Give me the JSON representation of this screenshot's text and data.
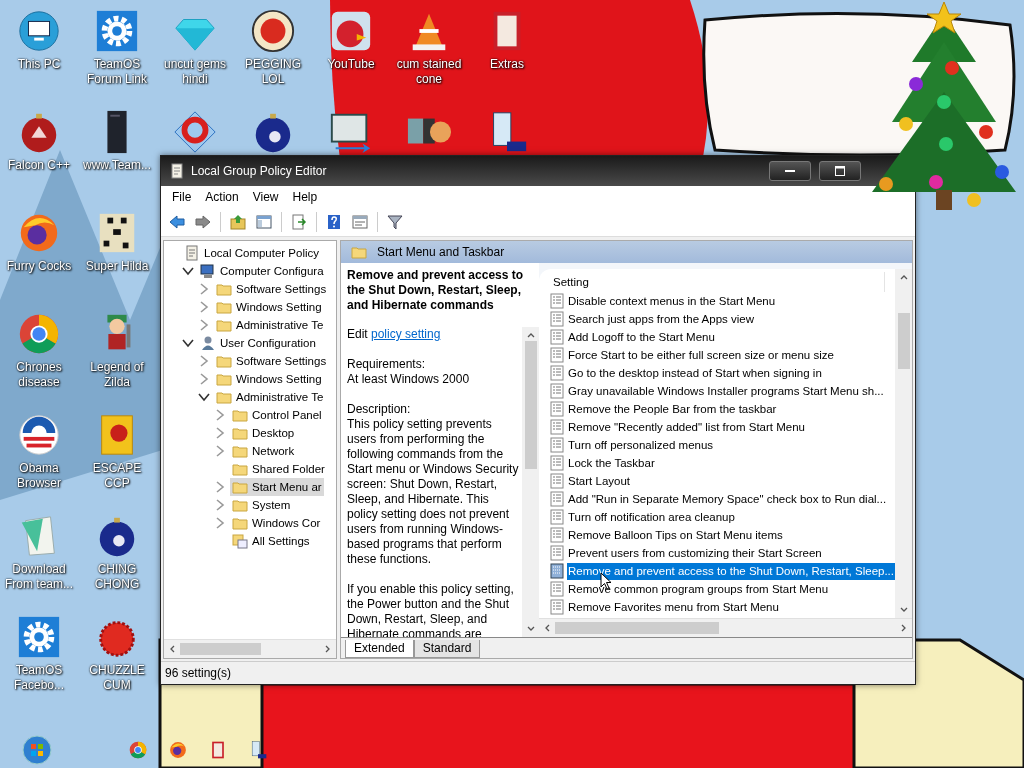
{
  "desktop": {
    "icon_columns": [
      [
        {
          "label": "This PC",
          "kind": "monitor"
        },
        {
          "label": "Falcon C++",
          "kind": "ornament"
        },
        {
          "label": "Furry Cocks",
          "kind": "flame"
        },
        {
          "label": "Chrones disease",
          "kind": "wheel"
        },
        {
          "label": "Obama Browser",
          "kind": "emblem"
        },
        {
          "label": "Download From team...",
          "kind": "notepad"
        },
        {
          "label": "TeamOS Facebo...",
          "kind": "gear"
        }
      ],
      [
        {
          "label": "TeamOS Forum Link",
          "kind": "gear"
        },
        {
          "label": "www.Team...",
          "kind": "book"
        },
        {
          "label": "Super Hilda",
          "kind": "pixel"
        },
        {
          "label": "Legend of Zilda",
          "kind": "character"
        },
        {
          "label": "ESCAPE CCP",
          "kind": "box"
        },
        {
          "label": "CHING CHONG",
          "kind": "ball"
        },
        {
          "label": "CHUZZLE CUM",
          "kind": "blob"
        }
      ],
      [
        {
          "label": "uncut gems hindi",
          "kind": "gem"
        },
        {
          "kind": "swirl"
        }
      ],
      [
        {
          "label": "PEGGING LOL",
          "kind": "disc"
        },
        {
          "kind": "ball"
        }
      ],
      [
        {
          "label": "YouTube",
          "kind": "bird"
        },
        {
          "kind": "code"
        }
      ],
      [
        {
          "label": "cum stained cone",
          "kind": "cone"
        },
        {
          "kind": "tiles"
        }
      ],
      [
        {
          "label": "Extras",
          "kind": "folder"
        },
        {
          "kind": "scroll"
        }
      ]
    ]
  },
  "window": {
    "title": "Local Group Policy Editor",
    "menu": [
      "File",
      "Action",
      "View",
      "Help"
    ]
  },
  "tree": [
    {
      "label": "Local Computer Policy",
      "kind": "policy",
      "selected": false,
      "children": [
        {
          "label": "Computer Configura",
          "kind": "computer",
          "expanded": true,
          "selected": false,
          "children": [
            {
              "label": "Software Settings",
              "kind": "folder",
              "expanded": false,
              "selected": false
            },
            {
              "label": "Windows Setting",
              "kind": "folder",
              "expanded": false,
              "selected": false
            },
            {
              "label": "Administrative Te",
              "kind": "folder",
              "expanded": false,
              "selected": false
            }
          ]
        },
        {
          "label": "User Configuration",
          "kind": "user",
          "expanded": true,
          "selected": false,
          "children": [
            {
              "label": "Software Settings",
              "kind": "folder",
              "expanded": false,
              "selected": false
            },
            {
              "label": "Windows Setting",
              "kind": "folder",
              "expanded": false,
              "selected": false
            },
            {
              "label": "Administrative Te",
              "kind": "folder",
              "expanded": true,
              "selected": false,
              "children": [
                {
                  "label": "Control Panel",
                  "kind": "folder",
                  "expanded": false,
                  "selected": false
                },
                {
                  "label": "Desktop",
                  "kind": "folder",
                  "expanded": false,
                  "selected": false
                },
                {
                  "label": "Network",
                  "kind": "folder",
                  "expanded": false,
                  "selected": false
                },
                {
                  "label": "Shared Folder",
                  "kind": "folder",
                  "selected": false
                },
                {
                  "label": "Start Menu ar",
                  "kind": "folder",
                  "expanded": false,
                  "selected": true
                },
                {
                  "label": "System",
                  "kind": "folder",
                  "expanded": false,
                  "selected": false
                },
                {
                  "label": "Windows Cor",
                  "kind": "folder",
                  "expanded": false,
                  "selected": false
                },
                {
                  "label": "All Settings",
                  "kind": "settings",
                  "selected": false
                }
              ]
            }
          ]
        }
      ]
    }
  ],
  "details": {
    "header": "Start Menu and Taskbar",
    "title": "Remove and prevent access to the Shut Down, Restart, Sleep, and Hibernate commands",
    "edit_prefix": "Edit",
    "edit_link": "policy setting",
    "requirements_label": "Requirements:",
    "requirements": "At least Windows 2000",
    "description_label": "Description:",
    "paragraphs": [
      "This policy setting prevents users from performing the following commands from the Start menu or Windows Security screen: Shut Down, Restart, Sleep, and Hibernate. This policy setting does not prevent users from running Windows-based programs that perform these functions.",
      "If you enable this policy setting, the Power button and the Shut Down, Restart, Sleep, and Hibernate commands are"
    ]
  },
  "settings": {
    "column": "Setting",
    "rows": [
      {
        "name": "Disable context menus in the Start Menu",
        "selected": false
      },
      {
        "name": "Search just apps from the Apps view",
        "selected": false
      },
      {
        "name": "Add Logoff to the Start Menu",
        "selected": false
      },
      {
        "name": "Force Start to be either full screen size or menu size",
        "selected": false
      },
      {
        "name": "Go to the desktop instead of Start when signing in",
        "selected": false
      },
      {
        "name": "Gray unavailable Windows Installer programs Start Menu sh...",
        "selected": false
      },
      {
        "name": "Remove the People Bar from the taskbar",
        "selected": false
      },
      {
        "name": "Remove \"Recently added\" list from Start Menu",
        "selected": false
      },
      {
        "name": "Turn off personalized menus",
        "selected": false
      },
      {
        "name": "Lock the Taskbar",
        "selected": false
      },
      {
        "name": "Start Layout",
        "selected": false
      },
      {
        "name": "Add \"Run in Separate Memory Space\" check box to Run dial...",
        "selected": false
      },
      {
        "name": "Turn off notification area cleanup",
        "selected": false
      },
      {
        "name": "Remove Balloon Tips on Start Menu items",
        "selected": false
      },
      {
        "name": "Prevent users from customizing their Start Screen",
        "selected": false
      },
      {
        "name": "Remove and prevent access to the Shut Down, Restart, Sleep...",
        "selected": true
      },
      {
        "name": "Remove common program groups from Start Menu",
        "selected": false
      },
      {
        "name": "Remove Favorites menu from Start Menu",
        "selected": false
      }
    ]
  },
  "tabs": [
    {
      "label": "Extended",
      "selected": true
    },
    {
      "label": "Standard",
      "selected": false
    }
  ],
  "status_bar": "96 setting(s)"
}
